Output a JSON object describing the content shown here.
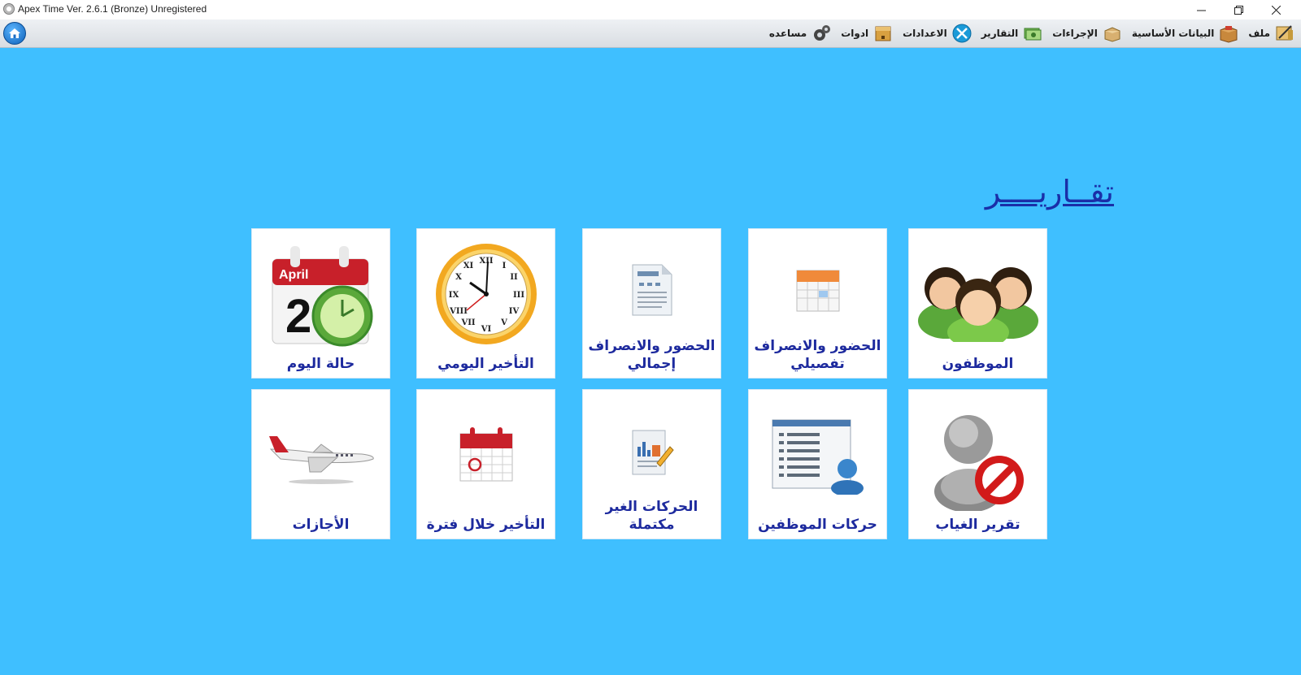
{
  "window": {
    "title": "Apex Time Ver. 2.6.1 (Bronze) Unregistered",
    "minimize_glyph": "—",
    "restore_glyph": "❐",
    "close_glyph": "✕"
  },
  "menu": {
    "items": [
      {
        "label": "ملف",
        "icon": "file-icon"
      },
      {
        "label": "البيانات الأساسية",
        "icon": "box-icon"
      },
      {
        "label": "الإجراءات",
        "icon": "procedures-icon"
      },
      {
        "label": "التقارير",
        "icon": "money-icon"
      },
      {
        "label": "الاعدادات",
        "icon": "settings-icon"
      },
      {
        "label": "ادوات",
        "icon": "tools-icon"
      },
      {
        "label": "مساعده",
        "icon": "gears-icon"
      }
    ]
  },
  "heading": "تقــاريــــر",
  "tiles": {
    "row1": [
      {
        "label": "الموظفون",
        "icon": "employees-icon"
      },
      {
        "label": "الحضور والانصراف",
        "label2": "تفصيلي",
        "icon": "calendar-icon"
      },
      {
        "label": "الحضور والانصراف",
        "label2": "إجمالي",
        "icon": "document-icon"
      },
      {
        "label": "التأخير اليومي",
        "icon": "clock-icon"
      },
      {
        "label": "حالة اليوم",
        "icon": "day-status-icon",
        "calendar_month": "April",
        "calendar_day": "2"
      }
    ],
    "row2": [
      {
        "label": "تقرير الغياب",
        "icon": "absence-icon"
      },
      {
        "label": "حركات الموظفين",
        "icon": "employee-movements-icon"
      },
      {
        "label": "الحركات الغير مكتملة",
        "icon": "report-chart-icon"
      },
      {
        "label": "التأخير خلال فترة",
        "icon": "calendar-period-icon"
      },
      {
        "label": "الأجازات",
        "icon": "airplane-icon"
      }
    ]
  },
  "colors": {
    "background": "#3fbfff",
    "tile": "#ffffff",
    "caption": "#1d2a9e",
    "heading": "#1a2fa8"
  }
}
